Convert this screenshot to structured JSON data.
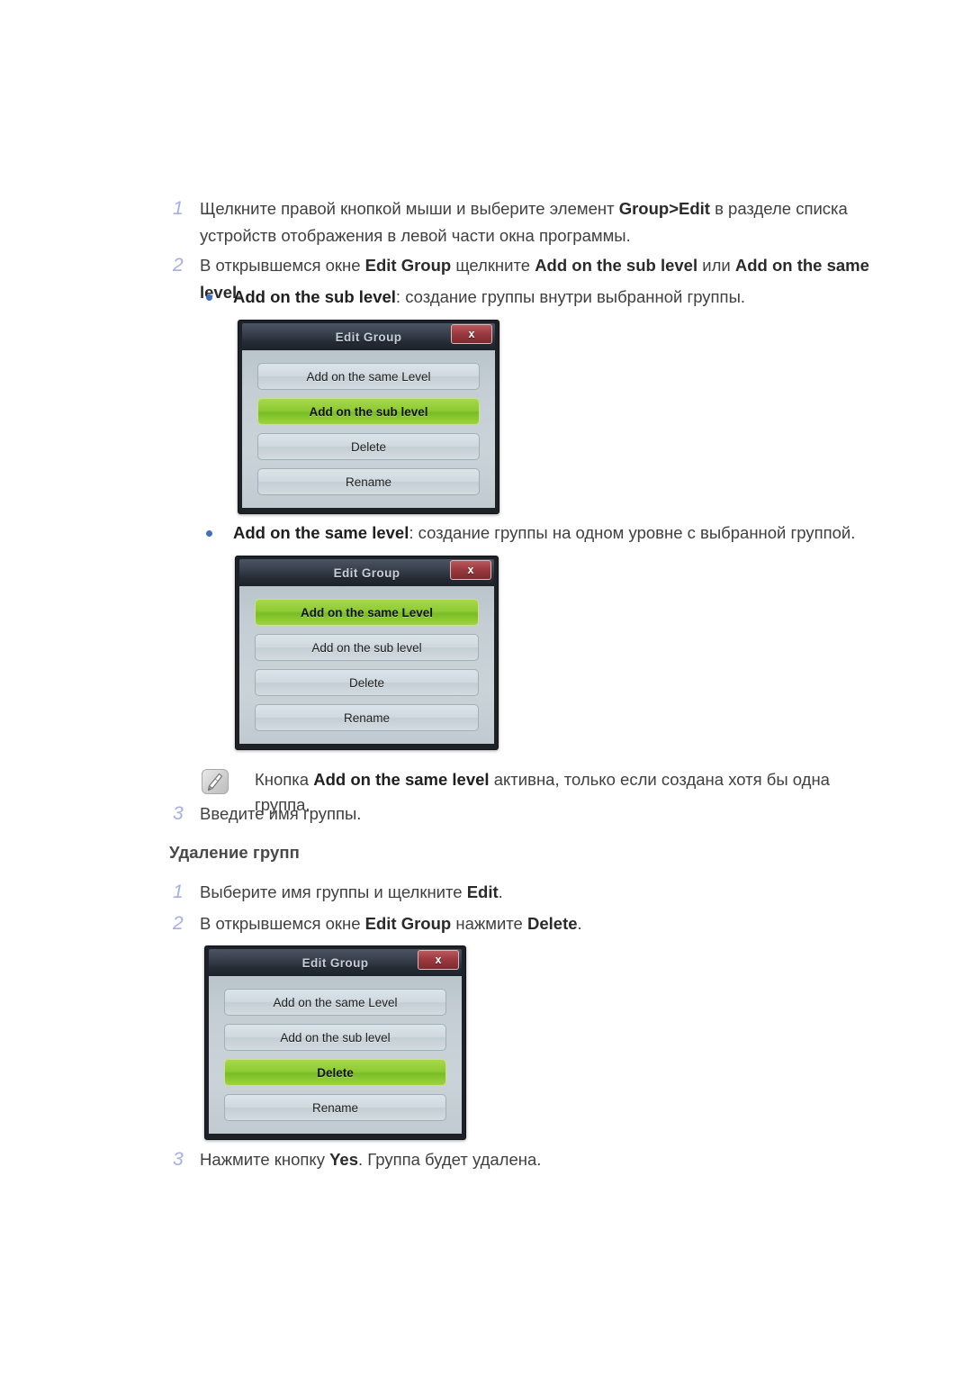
{
  "steps": [
    {
      "id": "step-1-create",
      "num": "1",
      "parts": [
        {
          "t": "Щелкните правой кнопкой мыши и выберите элемент ",
          "b": false
        },
        {
          "t": "Group>Edit",
          "b": true
        },
        {
          "t": " в разделе списка устройств отображения в левой части окна программы.",
          "b": false
        }
      ]
    },
    {
      "id": "step-2-create",
      "num": "2",
      "parts": [
        {
          "t": "В открывшемся окне ",
          "b": false
        },
        {
          "t": "Edit Group",
          "b": true
        },
        {
          "t": " щелкните ",
          "b": false
        },
        {
          "t": "Add on the sub level",
          "b": true
        },
        {
          "t": " или ",
          "b": false
        },
        {
          "t": "Add on the same level",
          "b": true
        },
        {
          "t": ".",
          "b": false
        }
      ]
    },
    {
      "id": "step-3-create",
      "num": "3",
      "parts": [
        {
          "t": "Введите имя группы.",
          "b": false
        }
      ]
    },
    {
      "id": "step-1-delete",
      "num": "1",
      "parts": [
        {
          "t": "Выберите имя группы и щелкните ",
          "b": false
        },
        {
          "t": "Edit",
          "b": true
        },
        {
          "t": ".",
          "b": false
        }
      ]
    },
    {
      "id": "step-2-delete",
      "num": "2",
      "parts": [
        {
          "t": "В открывшемся окне ",
          "b": false
        },
        {
          "t": "Edit Group",
          "b": true
        },
        {
          "t": " нажмите ",
          "b": false
        },
        {
          "t": "Delete",
          "b": true
        },
        {
          "t": ".",
          "b": false
        }
      ]
    },
    {
      "id": "step-3-delete",
      "num": "3",
      "parts": [
        {
          "t": "Нажмите кнопку ",
          "b": false
        },
        {
          "t": "Yes",
          "b": true
        },
        {
          "t": ". Группа будет удалена.",
          "b": false
        }
      ]
    }
  ],
  "bullets": [
    {
      "id": "bullet-sub-level",
      "parts": [
        {
          "t": "Add on the sub level",
          "b": true
        },
        {
          "t": ": создание группы внутри выбранной группы.",
          "b": false
        }
      ]
    },
    {
      "id": "bullet-same-level",
      "parts": [
        {
          "t": "Add on the same level",
          "b": true
        },
        {
          "t": ": создание группы на одном уровне с выбранной группой.",
          "b": false
        }
      ]
    }
  ],
  "note": {
    "icon": "note-pencil-icon",
    "parts": [
      {
        "t": "Кнопка ",
        "b": false
      },
      {
        "t": "Add on the same level",
        "b": true
      },
      {
        "t": " активна, только если создана хотя бы одна группа.",
        "b": false
      }
    ]
  },
  "headings": {
    "delete_groups": "Удаление групп"
  },
  "dialogs": [
    {
      "id": "dialog-edit-group-sub-level",
      "title": "Edit Group",
      "close_label": "x",
      "buttons": [
        {
          "label": "Add on the same Level",
          "active": false
        },
        {
          "label": "Add on the sub level",
          "active": true
        },
        {
          "label": "Delete",
          "active": false
        },
        {
          "label": "Rename",
          "active": false
        }
      ]
    },
    {
      "id": "dialog-edit-group-same-level",
      "title": "Edit Group",
      "close_label": "x",
      "buttons": [
        {
          "label": "Add on the same Level",
          "active": true
        },
        {
          "label": "Add on the sub level",
          "active": false
        },
        {
          "label": "Delete",
          "active": false
        },
        {
          "label": "Rename",
          "active": false
        }
      ]
    },
    {
      "id": "dialog-edit-group-delete",
      "title": "Edit Group",
      "close_label": "x",
      "buttons": [
        {
          "label": "Add on the same Level",
          "active": false
        },
        {
          "label": "Add on the sub level",
          "active": false
        },
        {
          "label": "Delete",
          "active": true
        },
        {
          "label": "Rename",
          "active": false
        }
      ]
    }
  ],
  "colors": {
    "step_number": "#a3aee6",
    "bullet": "#3f6fc4",
    "dialog_active_button": "#8ecb34",
    "dialog_close": "#9d3b40",
    "dialog_titlebar": "#3a424f"
  }
}
